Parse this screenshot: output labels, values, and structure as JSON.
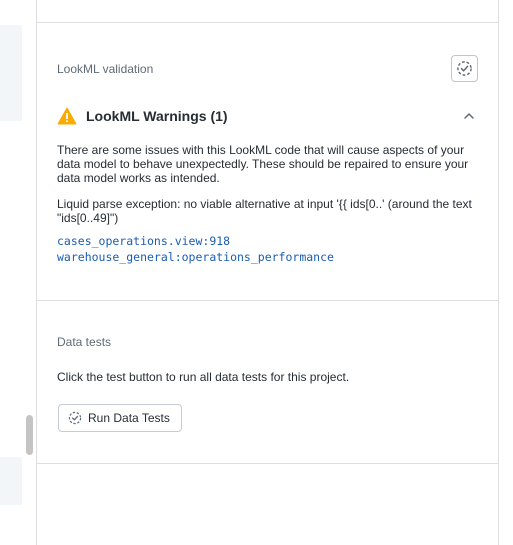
{
  "lookml_validation": {
    "title": "LookML validation",
    "validate_icon": "validate-check-icon"
  },
  "warnings": {
    "title": "LookML Warnings (1)",
    "icon": "warning-triangle-icon",
    "icon_color": "#f9ab00",
    "toggle_icon": "chevron-up-icon",
    "description": "There are some issues with this LookML code that will cause aspects of your data model to behave unexpectedly. These should be repaired to ensure your data model works as intended.",
    "error_message": "Liquid parse exception: no viable alternative at input '{{ ids[0..' (around the text \"ids[0..49]\")",
    "links": [
      "cases_operations.view:918",
      "warehouse_general:operations_performance"
    ],
    "link_color": "#1a5db3"
  },
  "data_tests": {
    "title": "Data tests",
    "description": "Click the test button to run all data tests for this project.",
    "button_label": "Run Data Tests",
    "button_icon": "run-tests-icon"
  }
}
